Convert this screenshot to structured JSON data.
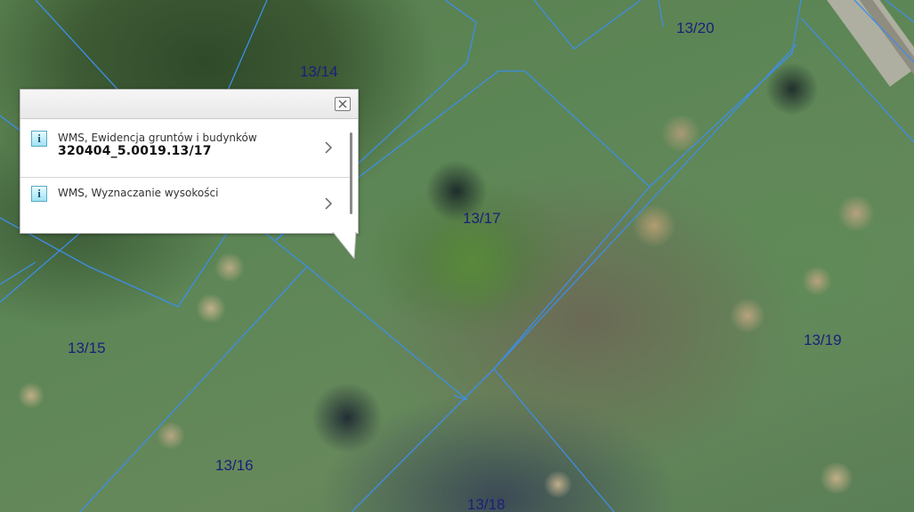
{
  "map": {
    "parcel_labels": [
      {
        "id": "p1314",
        "text": "13/14"
      },
      {
        "id": "p1320",
        "text": "13/20"
      },
      {
        "id": "p1317",
        "text": "13/17"
      },
      {
        "id": "p1315",
        "text": "13/15"
      },
      {
        "id": "p1319",
        "text": "13/19"
      },
      {
        "id": "p1316",
        "text": "13/16"
      },
      {
        "id": "p1318",
        "text": "13/18"
      }
    ],
    "boundary_color": "#3d8ee6",
    "label_color": "#1a1f7a"
  },
  "popup": {
    "close_icon": "close-icon",
    "items": [
      {
        "icon": "info-icon",
        "icon_glyph": "i",
        "title": "WMS, Ewidencja gruntów i budynków",
        "value": "320404_5.0019.13/17"
      },
      {
        "icon": "info-icon",
        "icon_glyph": "i",
        "title": "WMS, Wyznaczanie wysokości"
      }
    ]
  }
}
